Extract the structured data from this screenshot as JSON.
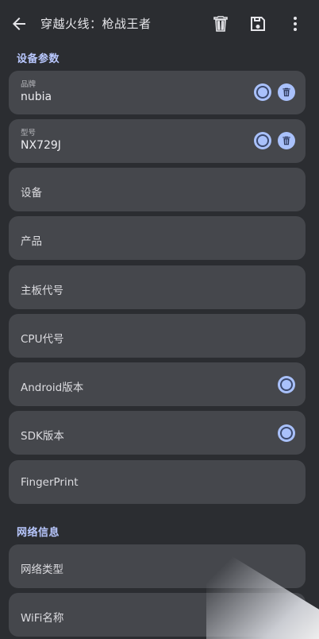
{
  "appbar": {
    "title": "穿越火线：枪战王者"
  },
  "sections": {
    "device": "设备参数",
    "network": "网络信息"
  },
  "fields": {
    "brand": {
      "label": "品牌",
      "value": "nubia"
    },
    "model": {
      "label": "型号",
      "value": "NX729J"
    },
    "device": {
      "label": "设备"
    },
    "product": {
      "label": "产品"
    },
    "board": {
      "label": "主板代号"
    },
    "cpu": {
      "label": "CPU代号"
    },
    "android": {
      "label": "Android版本"
    },
    "sdk": {
      "label": "SDK版本"
    },
    "fingerprint": {
      "label": "FingerPrint"
    },
    "network_type": {
      "label": "网络类型"
    },
    "wifi_name": {
      "label": "WiFi名称"
    }
  },
  "colors": {
    "background": "#2b2d31",
    "card": "#45474c",
    "accent": "#a9c1fb",
    "section_title": "#b9c8ff"
  },
  "icons": {
    "back": "arrow-left-icon",
    "delete": "trash-icon",
    "save": "save-icon",
    "more": "more-vertical-icon",
    "radio": "radio-icon"
  }
}
